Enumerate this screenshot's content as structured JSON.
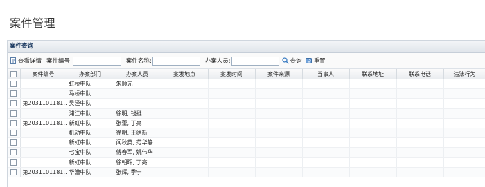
{
  "page": {
    "title": "案件管理"
  },
  "panel": {
    "title": "案件查询"
  },
  "toolbar": {
    "view_label": "查看详情",
    "case_no_label": "案件编号:",
    "case_name_label": "案件名称:",
    "handler_label": "办案人员:",
    "case_no_value": "",
    "case_name_value": "",
    "handler_value": "",
    "search_label": "查询",
    "reset_label": "重置"
  },
  "icons": {
    "view": "document-icon",
    "search": "magnifier-icon",
    "reset": "reset-icon"
  },
  "colors": {
    "header_text": "#15345c",
    "accent": "#3f7fc4"
  },
  "table": {
    "columns": [
      "案件编号",
      "办案部门",
      "办案人员",
      "案发地点",
      "案发时间",
      "案件来源",
      "当事人",
      "联系地址",
      "联系电话",
      "违法行为"
    ],
    "rows": [
      [
        "",
        "虹桥中队",
        "朱顺元",
        "",
        "",
        "",
        "",
        "",
        "",
        ""
      ],
      [
        "",
        "马桥中队",
        "",
        "",
        "",
        "",
        "",
        "",
        "",
        ""
      ],
      [
        "第2031101181…",
        "吴泾中队",
        "",
        "",
        "",
        "",
        "",
        "",
        "",
        ""
      ],
      [
        "",
        "浦江中队",
        "徐明, 钱挺",
        "",
        "",
        "",
        "",
        "",
        "",
        ""
      ],
      [
        "第2031101181…",
        "新虹中队",
        "张蕾, 丁亮",
        "",
        "",
        "",
        "",
        "",
        "",
        ""
      ],
      [
        "",
        "机动中队",
        "徐明, 王纳新",
        "",
        "",
        "",
        "",
        "",
        "",
        ""
      ],
      [
        "",
        "新虹中队",
        "闻秋英, 范华静",
        "",
        "",
        "",
        "",
        "",
        "",
        ""
      ],
      [
        "",
        "七宝中队",
        "傅春军, 姚伟华",
        "",
        "",
        "",
        "",
        "",
        "",
        ""
      ],
      [
        "",
        "新虹中队",
        "徐朝晖, 丁亮",
        "",
        "",
        "",
        "",
        "",
        "",
        ""
      ],
      [
        "第2031101181…",
        "华漕中队",
        "张辉, 季宁",
        "",
        "",
        "",
        "",
        "",
        "",
        ""
      ]
    ]
  }
}
